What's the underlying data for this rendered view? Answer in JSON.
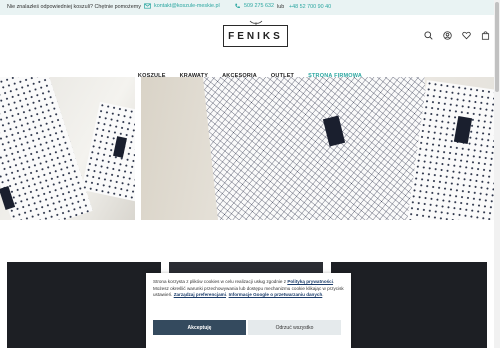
{
  "topbar": {
    "help": "Nie znalazłeś odpowiedniej koszuli? Chętnie pomożemy",
    "email": "kontakt@koszule-meskie.pl",
    "phone1": "509 275 632",
    "or": "lub",
    "phone2": "+48 52 700 90 40"
  },
  "header": {
    "logo": "FENIKS"
  },
  "nav": {
    "items": [
      "KOSZULE",
      "KRAWATY",
      "AKCESORIA",
      "OUTLET",
      "STRONA FIRMOWA"
    ]
  },
  "cookie": {
    "text1": "Strona korzysta z plików cookies w celu realizacji usług zgodnie z ",
    "link1": "Polityką prywatności",
    "text2": ". Możesz określić warunki przechowywania lub dostępu mechanizmu cookie klikając w przycisk ustawień. ",
    "link2": "Zarządzaj preferencjami",
    "text3": ". ",
    "link3": "Informacje Google o przetwarzaniu danych",
    "text4": ".",
    "accept": "Akceptuję",
    "reject": "Odrzuć wszystko"
  },
  "colors": {
    "accent": "#2aa6a0",
    "topbar_bg": "#e9f3f3",
    "accept_bg": "#344a5e"
  }
}
